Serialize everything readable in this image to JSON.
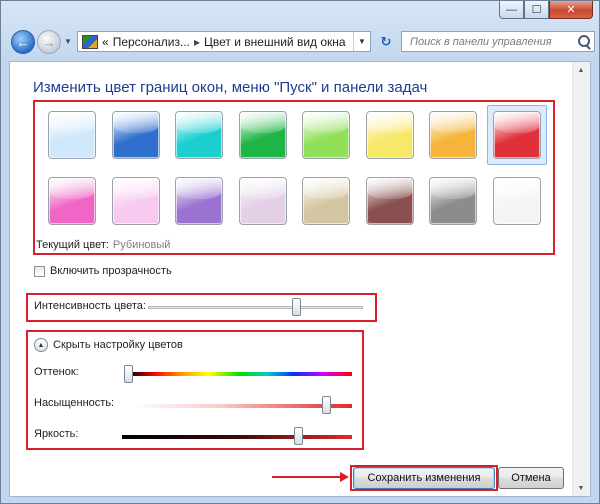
{
  "window": {
    "minimize_glyph": "—",
    "maximize_glyph": "☐",
    "close_glyph": "✕"
  },
  "nav": {
    "back_glyph": "←",
    "forward_glyph": "→",
    "dropdown_glyph": "▼",
    "breadcrumb_prefix": "«",
    "breadcrumb": [
      "Персонализ...",
      "Цвет и внешний вид окна"
    ],
    "breadcrumb_separator": "▸",
    "refresh_glyph": "↻",
    "search_placeholder": "Поиск в панели управления"
  },
  "page": {
    "title": "Изменить цвет границ окон, меню \"Пуск\" и панели задач",
    "swatches": [
      {
        "name": "sky",
        "color": "#cfe6fb"
      },
      {
        "name": "twilight",
        "color": "#2f6fce"
      },
      {
        "name": "sea",
        "color": "#1ccfcf"
      },
      {
        "name": "leaf",
        "color": "#1fb545"
      },
      {
        "name": "lime",
        "color": "#92e05a"
      },
      {
        "name": "lightning",
        "color": "#f8e86a"
      },
      {
        "name": "pumpkin",
        "color": "#f6b43a"
      },
      {
        "name": "ruby",
        "color": "#e0303a",
        "selected": true
      },
      {
        "name": "fuchsia",
        "color": "#f066c6"
      },
      {
        "name": "blush",
        "color": "#f8c9ef"
      },
      {
        "name": "violet",
        "color": "#9a73d2"
      },
      {
        "name": "lavender",
        "color": "#e3cfe6"
      },
      {
        "name": "taupe",
        "color": "#d5c6a3"
      },
      {
        "name": "chocolate",
        "color": "#8a4f4f"
      },
      {
        "name": "slate",
        "color": "#8c8c8c"
      },
      {
        "name": "frost",
        "color": "#f4f4f4"
      }
    ],
    "current_color_label": "Текущий цвет:",
    "current_color_value": "Рубиновый",
    "transparency_label": "Включить прозрачность",
    "transparency_checked": false,
    "intensity_label": "Интенсивность цвета:",
    "intensity_level": 0.7,
    "collapse_glyph": "▲",
    "collapse_label": "Скрыть настройку цветов",
    "hue_label": "Оттенок:",
    "hue_level": 0.0,
    "saturation_label": "Насыщенность:",
    "saturation_level": 0.9,
    "brightness_label": "Яркость:",
    "brightness_level": 0.78
  },
  "buttons": {
    "save_label": "Сохранить изменения",
    "cancel_label": "Отмена"
  },
  "scrollbar": {
    "up_glyph": "▲",
    "down_glyph": "▼"
  },
  "colors": {
    "highlight_red": "#d8202a",
    "title_blue": "#1f3d8f",
    "selection_blue": "#dceaf9"
  }
}
